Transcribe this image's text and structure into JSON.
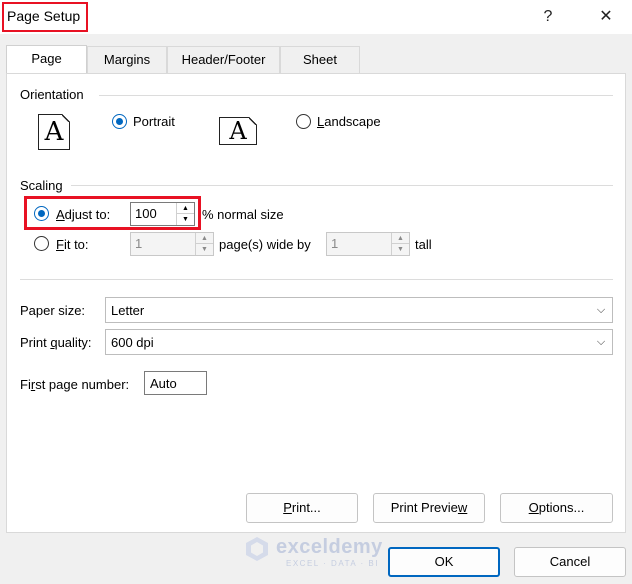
{
  "window": {
    "title": "Page Setup",
    "help_glyph": "?",
    "close_glyph": "✕"
  },
  "tabs": [
    {
      "label": "Page",
      "active": true
    },
    {
      "label": "Margins",
      "active": false
    },
    {
      "label": "Header/Footer",
      "active": false
    },
    {
      "label": "Sheet",
      "active": false
    }
  ],
  "orientation": {
    "label": "Orientation",
    "portrait_label": "Portrait",
    "landscape_label": "Landscape",
    "selected": "portrait",
    "icon_letter": "A"
  },
  "scaling": {
    "label": "Scaling",
    "adjust_to_label": "Adjust to:",
    "adjust_to_value": "100",
    "adjust_suffix": "% normal size",
    "fit_to_label": "Fit to:",
    "fit_wide_value": "1",
    "fit_wide_suffix": "page(s) wide by",
    "fit_tall_value": "1",
    "fit_tall_suffix": "tall",
    "selected": "adjust"
  },
  "paper": {
    "paper_size_label": "Paper size:",
    "paper_size_value": "Letter",
    "print_quality_label": "Print quality:",
    "print_quality_value": "600 dpi",
    "first_page_label": "First page number:",
    "first_page_value": "Auto"
  },
  "buttons": {
    "print": "Print...",
    "print_preview": "Print Preview",
    "options": "Options...",
    "ok": "OK",
    "cancel": "Cancel"
  },
  "watermark": {
    "brand": "exceldemy",
    "tagline": "EXCEL · DATA · BI"
  },
  "colors": {
    "accent": "#0067c0",
    "highlight": "#e81123"
  }
}
